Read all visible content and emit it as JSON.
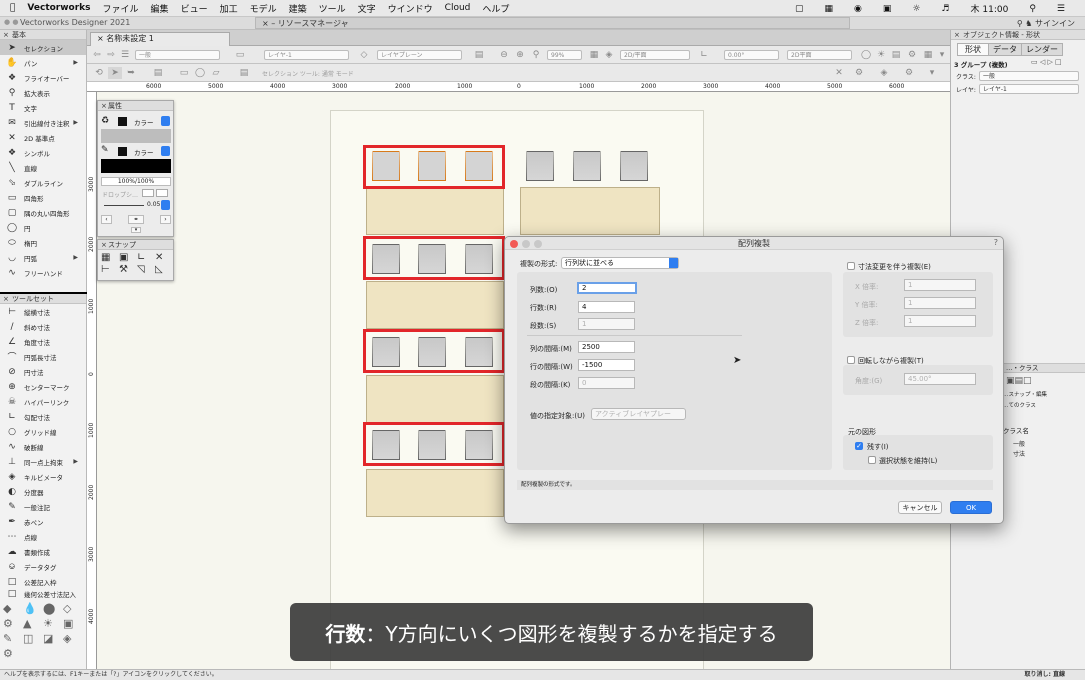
{
  "menubar": {
    "app": "Vectorworks",
    "items": [
      "ファイル",
      "編集",
      "ビュー",
      "加工",
      "モデル",
      "建築",
      "ツール",
      "文字",
      "ウインドウ",
      "Cloud",
      "ヘルプ"
    ],
    "clock": "木 11:00"
  },
  "titlerow": {
    "window_title": "Vectorworks Designer 2021",
    "resource_manager": "リソースマネージャ",
    "signin": "サインイン"
  },
  "basic_palette": {
    "title": "基本",
    "tools": [
      "セレクション",
      "パン",
      "フライオーバー",
      "拡大表示",
      "文字",
      "引出線付き注釈",
      "2D 基準点",
      "シンボル",
      "直線",
      "ダブルライン",
      "四角形",
      "隅の丸い四角形",
      "円",
      "楕円",
      "円弧",
      "フリーハンド"
    ]
  },
  "toolset_palette": {
    "title": "ツールセット",
    "tools": [
      "縦横寸法",
      "斜め寸法",
      "角度寸法",
      "円弧長寸法",
      "円寸法",
      "センターマーク",
      "ハイパーリンク",
      "勾配寸法",
      "グリッド線",
      "破断線",
      "同一点上拘束",
      "キルビメータ",
      "分度器",
      "一般注記",
      "赤ペン",
      "点線",
      "書類作成",
      "データタグ",
      "公差記入枠",
      "幾何公差寸法記入"
    ]
  },
  "document": {
    "tab": "名称未設定 1"
  },
  "toolbar": {
    "class_field": "一般",
    "layer_field": "レイヤ-1",
    "layer_plane": "レイヤプレーン",
    "zoom": "99%",
    "view": "2D/平面",
    "angle": "0.00°",
    "mode_hint": "セレクション ツール: 通常 モード",
    "render": "2D平面"
  },
  "ruler_h": [
    "6000",
    "5000",
    "4000",
    "3000",
    "2000",
    "1000",
    "0",
    "1000",
    "2000",
    "3000",
    "4000",
    "5000",
    "6000"
  ],
  "ruler_v": [
    "3000",
    "2000",
    "1000",
    "0",
    "1000",
    "2000",
    "3000",
    "4000"
  ],
  "attributes": {
    "title": "属性",
    "fill": "カラー",
    "pen": "カラー",
    "opacity": "100%/100%",
    "dropshadow": "ドロップシ…",
    "thickness": "0.05"
  },
  "snap": {
    "title": "スナップ"
  },
  "right_panel": {
    "title": "オブジェクト情報 - 形状",
    "tabs": [
      "形状",
      "データ",
      "レンダー"
    ],
    "object": "3 グループ (複数)",
    "class_label": "クラス:",
    "class_value": "一般",
    "layer_label": "レイヤ:",
    "layer_value": "レイヤ-1",
    "nav_title": "…・クラス",
    "nav_items": [
      "…スナップ・編集",
      "…てのクラス"
    ],
    "class_col": "クラス名",
    "class_rows": [
      "一般",
      "寸法"
    ]
  },
  "dialog": {
    "title": "配列複製",
    "type_label": "複製の形式:",
    "type_value": "行列状に並べる",
    "cols_label": "列数:(O)",
    "cols_value": "2",
    "rows_label": "行数:(R)",
    "rows_value": "4",
    "stages_label": "段数:(S)",
    "stages_value": "1",
    "col_gap_label": "列の間隔:(M)",
    "col_gap_value": "2500",
    "row_gap_label": "行の間隔:(W)",
    "row_gap_value": "-1500",
    "stage_gap_label": "段の間隔:(K)",
    "stage_gap_value": "0",
    "target_label": "値の指定対象:(U)",
    "target_value": "アクティブレイヤプレー",
    "scale_check": "寸法変更を伴う複製(E)",
    "x_label": "X 倍率:",
    "x_value": "1",
    "y_label": "Y 倍率:",
    "y_value": "1",
    "z_label": "Z 倍率:",
    "z_value": "1",
    "rotate_check": "回転しながら複製(T)",
    "angle_label": "角度:(G)",
    "angle_value": "45.00°",
    "original_title": "元の図形",
    "keep_label": "残す(I)",
    "keep_checked": true,
    "keep_selection_label": "選択状態を維持(L)",
    "status": "配列複製の形式です。",
    "cancel": "キャンセル",
    "ok": "OK"
  },
  "caption": {
    "bold": "行数",
    "text": "：Y方向にいくつ図形を複製するかを指定する"
  },
  "statusbar": {
    "left": "ヘルプを表示するには、F1キーまたは「?」アイコンをクリックしてください。",
    "right": "取り消し: 直線"
  }
}
